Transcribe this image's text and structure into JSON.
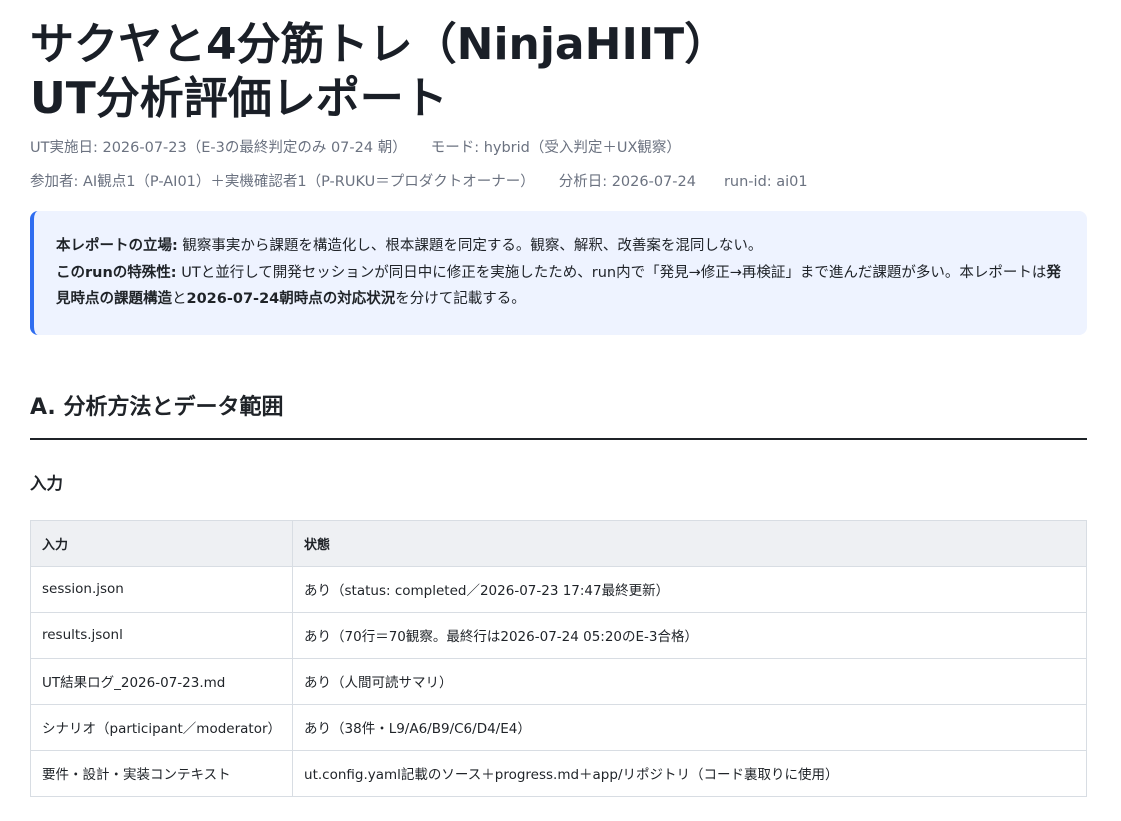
{
  "header": {
    "title_line1": "サクヤと4分筋トレ（NinjaHIIT）",
    "title_line2": "UT分析評価レポート",
    "meta_row1": {
      "date": "UT実施日: 2026-07-23（E-3の最終判定のみ 07-24 朝）",
      "mode": "モード: hybrid（受入判定＋UX観察）"
    },
    "meta_row2": {
      "participants": "参加者: AI観点1（P-AI01）＋実機確認者1（P-RUKU＝プロダクトオーナー）",
      "analysis_date": "分析日: 2026-07-24",
      "run_id": "run-id: ai01"
    }
  },
  "callout": {
    "stance_label": "本レポートの立場:",
    "stance_text": " 観察事実から課題を構造化し、根本課題を同定する。観察、解釈、改善案を混同しない。",
    "run_label": "このrunの特殊性:",
    "run_text": " UTと並行して開発セッションが同日中に修正を実施したため、run内で「発見→修正→再検証」まで進んだ課題が多い。本レポートは",
    "bold_1": "発見時点の課題構造",
    "mid_text": "と",
    "bold_2": "2026-07-24朝時点の対応状況",
    "end_text": "を分けて記載する。"
  },
  "section_a": {
    "heading": "A. 分析方法とデータ範囲",
    "subheading": "入力",
    "table": {
      "headers": [
        "入力",
        "状態"
      ],
      "rows": [
        [
          "session.json",
          "あり（status: completed／2026-07-23 17:47最終更新）"
        ],
        [
          "results.jsonl",
          "あり（70行＝70観察。最終行は2026-07-24 05:20のE-3合格）"
        ],
        [
          "UT結果ログ_2026-07-23.md",
          "あり（人間可読サマリ）"
        ],
        [
          "シナリオ（participant／moderator）",
          "あり（38件・L9/A6/B9/C6/D4/E4）"
        ],
        [
          "要件・設計・実装コンテキスト",
          "ut.config.yaml記載のソース＋progress.md＋app/リポジトリ（コード裏取りに使用）"
        ]
      ]
    }
  }
}
